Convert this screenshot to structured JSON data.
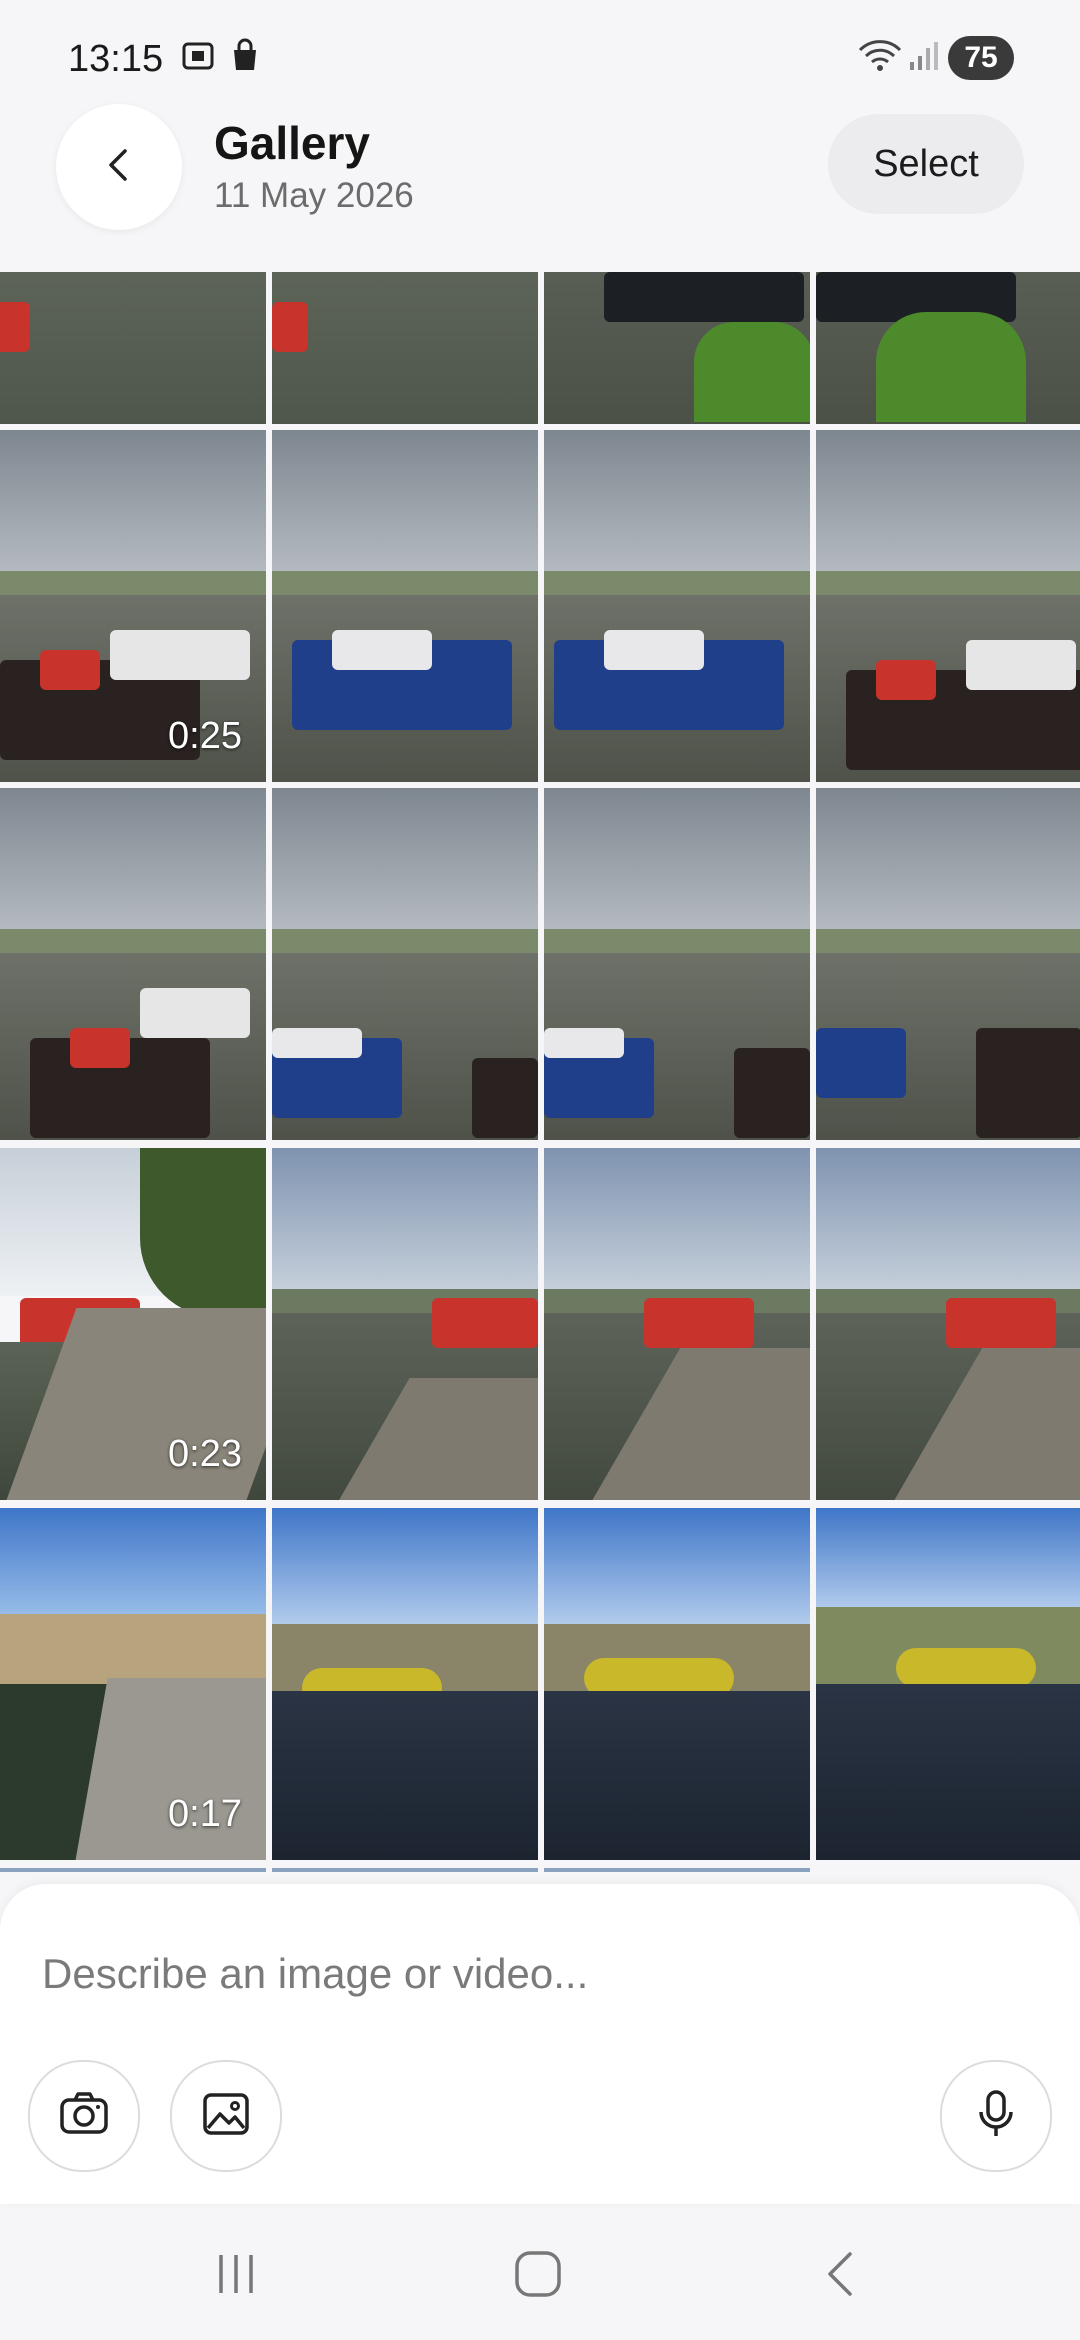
{
  "status_bar": {
    "time": "13:15",
    "battery": "75",
    "icons": [
      "screenshot-icon",
      "bag-icon",
      "wifi-icon",
      "signal-icon"
    ]
  },
  "header": {
    "title": "Gallery",
    "date": "11 May 2026",
    "select_label": "Select",
    "back_icon": "chevron-left-icon"
  },
  "grid": {
    "durations": {
      "r1c0": "0:25",
      "r3c0": "0:23",
      "r4c0": "0:17"
    }
  },
  "composer": {
    "placeholder": "Describe an image or video...",
    "camera_icon": "camera-icon",
    "gallery_icon": "image-icon",
    "mic_icon": "microphone-icon"
  },
  "nav": {
    "icons": [
      "recent-apps-icon",
      "home-icon",
      "back-icon"
    ]
  },
  "colors": {
    "background": "#f6f6f8",
    "sky_grey": "#9aa3ad",
    "sky_blue": "#4f86d6",
    "water": "#5d6358",
    "boat_red": "#c8332c",
    "boat_blue": "#1f3f8a"
  }
}
